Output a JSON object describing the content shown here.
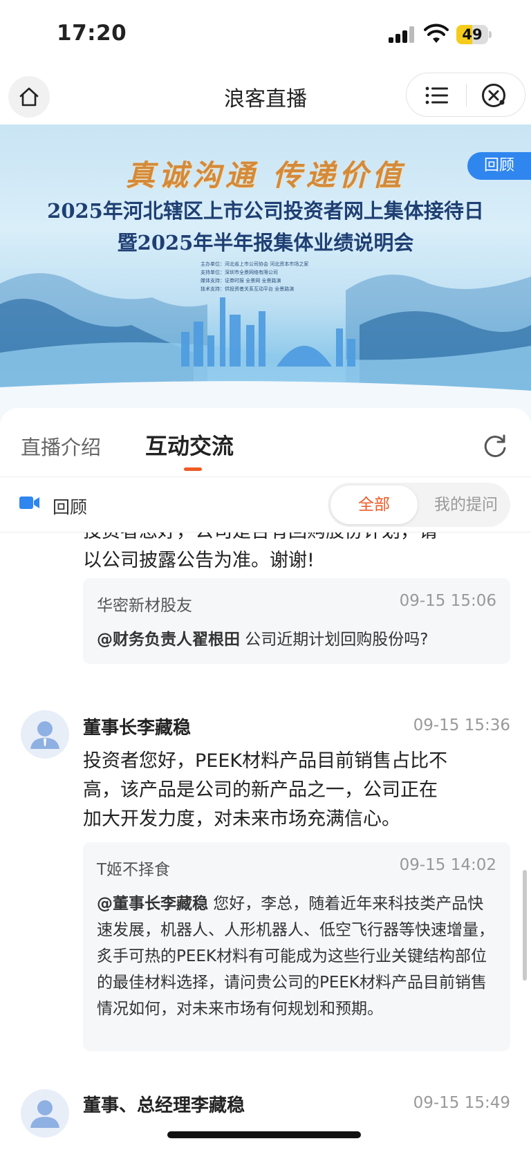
{
  "status_bar": {
    "time": "17:20",
    "battery": "49",
    "battery_level": 0.49
  },
  "nav": {
    "title": "浪客直播"
  },
  "banner": {
    "slogan": "真诚沟通  传递价值",
    "title_line1": "2025年河北辖区上市公司投资者网上集体接待日",
    "title_line2": "暨2025年半年报集体业绩说明会",
    "small_lines": [
      "主办单位：河北省上市公司协会 河北资本市场之家",
      "支持单位：深圳市全景网络有限公司",
      "媒体支持：证券时报 全景网 全景路演",
      "技术支持：供投资者关系互动平台 全景路演"
    ],
    "badge": "回顾"
  },
  "tabs": {
    "intro": "直播介绍",
    "chat": "互动交流"
  },
  "filter": {
    "replay": "回顾",
    "all": "全部",
    "mine": "我的提问"
  },
  "feed": {
    "partial_answer_line1": "投资者您好，公司是否有回购股份计划，请",
    "partial_answer_line2": "以公司披露公告为准。谢谢!",
    "q1": {
      "user": "华密新材股友",
      "time": "09-15 15:06",
      "mention": "@财务负责人翟根田",
      "text": " 公司近期计划回购股份吗?"
    },
    "post2": {
      "author": "董事长李藏稳",
      "time": "09-15 15:36",
      "answer_lines": [
        "投资者您好，PEEK材料产品目前销售占比不",
        "高，该产品是公司的新产品之一，公司正在",
        "加大开发力度，对未来市场充满信心。"
      ],
      "question": {
        "user": "T姬不择食",
        "time": "09-15 14:02",
        "mention": "@董事长李藏稳",
        "text": " 您好，李总，随着近年来科技类产品快速发展，机器人、人形机器人、低空飞行器等快速增量，炙手可热的PEEK材料有可能成为这些行业关键结构部位的最佳材料选择，请问贵公司的PEEK材料产品目前销售情况如何，对未来市场有何规划和预期。"
      }
    },
    "post3": {
      "author": "董事、总经理李藏稳",
      "time": "09-15 15:49"
    }
  }
}
